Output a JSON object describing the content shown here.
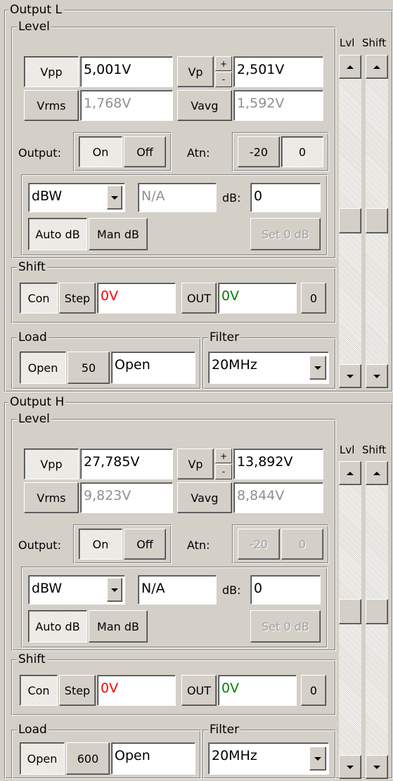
{
  "panels": [
    {
      "title": "Output L",
      "level": {
        "title": "Level",
        "vpp_label": "Vpp",
        "vpp_value": "5,001V",
        "vp_label": "Vp",
        "vp_value": "2,501V",
        "vrms_label": "Vrms",
        "vrms_value": "1,768V",
        "vavg_label": "Vavg",
        "vavg_value": "1,592V",
        "spin_up": "+",
        "spin_down": "-",
        "output_label": "Output:",
        "on_label": "On",
        "off_label": "Off",
        "atn_label": "Atn:",
        "atn_m20": "-20",
        "atn_0": "0",
        "unit_select": "dBW",
        "unit_value": "N/A",
        "db_label": "dB:",
        "db_value": "0",
        "auto_db": "Auto dB",
        "man_db": "Man dB",
        "set0": "Set 0 dB"
      },
      "shift": {
        "title": "Shift",
        "con": "Con",
        "step": "Step",
        "value": "0V",
        "out": "OUT",
        "out_value": "0V",
        "zero": "0"
      },
      "load": {
        "title": "Load",
        "open": "Open",
        "value_button": "50",
        "value": "Open"
      },
      "filter": {
        "title": "Filter",
        "value": "20MHz"
      },
      "scroll": {
        "lvl": "Lvl",
        "shift": "Shift"
      }
    },
    {
      "title": "Output H",
      "level": {
        "title": "Level",
        "vpp_label": "Vpp",
        "vpp_value": "27,785V",
        "vp_label": "Vp",
        "vp_value": "13,892V",
        "vrms_label": "Vrms",
        "vrms_value": "9,823V",
        "vavg_label": "Vavg",
        "vavg_value": "8,844V",
        "spin_up": "+",
        "spin_down": "-",
        "output_label": "Output:",
        "on_label": "On",
        "off_label": "Off",
        "atn_label": "Atn:",
        "atn_m20": "-20",
        "atn_0": "0",
        "unit_select": "dBW",
        "unit_value": "N/A",
        "db_label": "dB:",
        "db_value": "0",
        "auto_db": "Auto dB",
        "man_db": "Man dB",
        "set0": "Set 0 dB"
      },
      "shift": {
        "title": "Shift",
        "con": "Con",
        "step": "Step",
        "value": "0V",
        "out": "OUT",
        "out_value": "0V",
        "zero": "0"
      },
      "load": {
        "title": "Load",
        "open": "Open",
        "value_button": "600",
        "value": "Open"
      },
      "filter": {
        "title": "Filter",
        "value": "20MHz"
      },
      "scroll": {
        "lvl": "Lvl",
        "shift": "Shift"
      }
    }
  ]
}
